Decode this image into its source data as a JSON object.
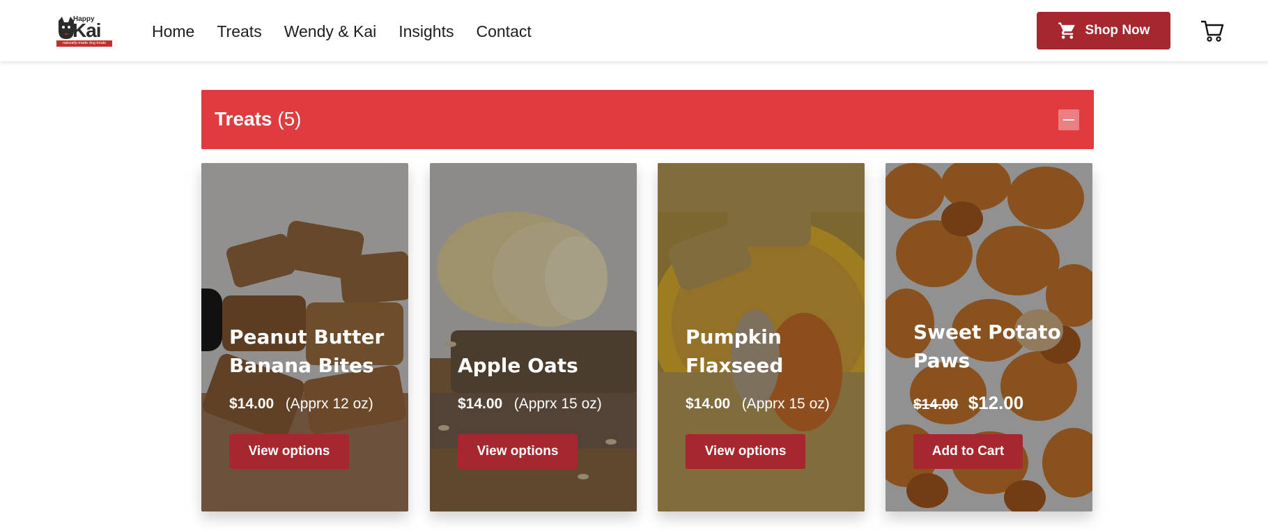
{
  "header": {
    "logo": {
      "top": "Happy",
      "main": "Kai",
      "tagline": "naturally-made dog treats"
    },
    "nav": [
      "Home",
      "Treats",
      "Wendy & Kai",
      "Insights",
      "Contact"
    ],
    "shop_button": "Shop Now"
  },
  "section": {
    "title": "Treats",
    "count": "(5)"
  },
  "products": [
    {
      "name": "Peanut Butter Banana Bites",
      "price": "$14.00",
      "size": "(Apprx 12 oz)",
      "button": "View options"
    },
    {
      "name": "Apple Oats",
      "price": "$14.00",
      "size": "(Apprx 15 oz)",
      "button": "View options"
    },
    {
      "name": "Pumpkin Flaxseed",
      "price": "$14.00",
      "size": "(Apprx 15 oz)",
      "button": "View options"
    },
    {
      "name": "Sweet Potato Paws",
      "old_price": "$14.00",
      "sale_price": "$12.00",
      "button": "Add to Cart"
    }
  ],
  "colors": {
    "accent_red": "#e03c3f",
    "button_red": "#a6272d"
  },
  "icons": {
    "shop": "shopping-cart-icon",
    "cart": "cart-outline-icon",
    "collapse": "minus-icon"
  }
}
